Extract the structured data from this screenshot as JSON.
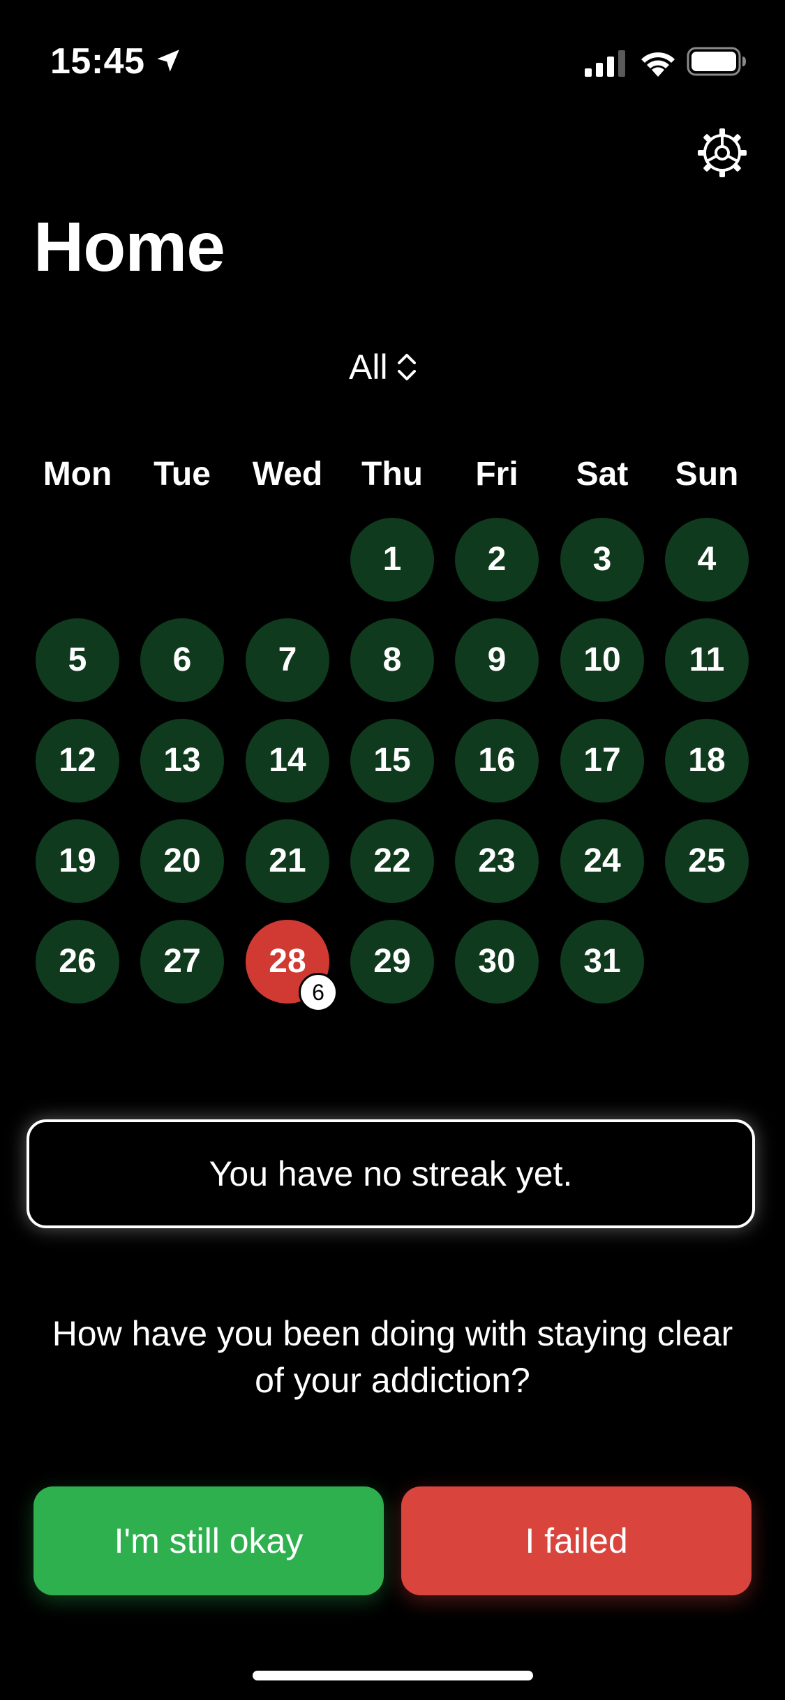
{
  "status_bar": {
    "time": "15:45",
    "icons": [
      "location-arrow-icon",
      "cellular-signal-icon",
      "wifi-icon",
      "battery-icon"
    ]
  },
  "header": {
    "settings_icon": "gear-icon",
    "title": "Home"
  },
  "filter": {
    "selected": "All",
    "icon": "chevron-up-down-icon"
  },
  "calendar": {
    "weekdays": [
      "Mon",
      "Tue",
      "Wed",
      "Thu",
      "Fri",
      "Sat",
      "Sun"
    ],
    "first_weekday_index": 3,
    "days": [
      "1",
      "2",
      "3",
      "4",
      "5",
      "6",
      "7",
      "8",
      "9",
      "10",
      "11",
      "12",
      "13",
      "14",
      "15",
      "16",
      "17",
      "18",
      "19",
      "20",
      "21",
      "22",
      "23",
      "24",
      "25",
      "26",
      "27",
      "28",
      "29",
      "30",
      "31"
    ],
    "failed_day": "28",
    "failed_day_badge": "6"
  },
  "streak": {
    "text": "You have no streak yet."
  },
  "prompt": {
    "question": "How have you been doing with staying clear of your addiction?"
  },
  "actions": {
    "okay_label": "I'm still okay",
    "failed_label": "I failed"
  },
  "colors": {
    "background": "#000000",
    "day_ok": "#0f3a1d",
    "day_failed": "#d03a32",
    "button_okay": "#2fb04f",
    "button_failed": "#d9443d"
  }
}
